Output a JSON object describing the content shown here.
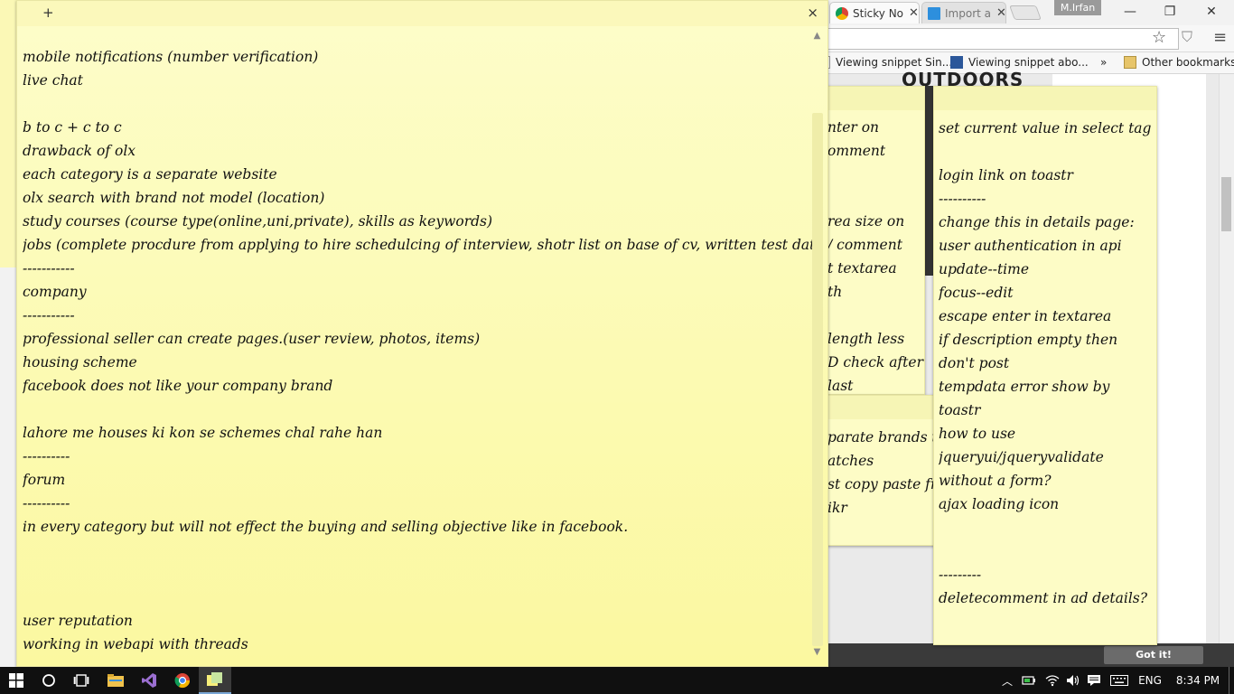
{
  "browser": {
    "tabs": [
      {
        "label": "Sticky No",
        "active": true,
        "icon": "chrome-icon"
      },
      {
        "label": "Import a",
        "active": false,
        "icon": "windows-icon"
      }
    ],
    "user_chip": "M.Irfan",
    "bookmarks": [
      {
        "label": "Viewing snippet Sin...",
        "icon": "document-icon"
      },
      {
        "label": "Viewing snippet abo...",
        "icon": "blogger-icon"
      },
      {
        "label": "»",
        "icon": ""
      },
      {
        "label": "Other bookmarks",
        "icon": "folder-icon"
      }
    ],
    "page_heading": "OUTDOORS",
    "got_it_label": "Got it!"
  },
  "main_note": {
    "add_symbol": "+",
    "close_symbol": "×",
    "lines": [
      "mobile notifications (number verification)",
      "live chat",
      "",
      "b to c + c to c",
      "drawback of olx",
      "each category is a separate website",
      "olx search with brand not model (location)",
      "study courses (course type(online,uni,private), skills as keywords)",
      "jobs (complete procdure from applying to hire schedulcing of interview, shotr list on base of cv, written test date)",
      "-----------",
      "company",
      "-----------",
      "professional seller can create pages.(user review, photos, items)",
      "housing scheme",
      "facebook does not like your company brand",
      "",
      "lahore me houses ki kon se schemes chal rahe han",
      "----------",
      "forum",
      "----------",
      "in every category but will not effect the buying and selling objective like in facebook.",
      "",
      "",
      "",
      "user reputation",
      "working in webapi with threads"
    ]
  },
  "mid_note": {
    "lines": [
      "nter on",
      "omment",
      "",
      "",
      "rea size on",
      "/ comment",
      "t textarea",
      "th",
      "",
      "length less",
      "D check after",
      "last"
    ]
  },
  "mid2_note": {
    "lines": [
      "parate brands t",
      "atches",
      "st copy paste fr",
      "ikr"
    ]
  },
  "right_note": {
    "lines": [
      "set current value in select tag",
      "",
      "login link on toastr",
      "----------",
      "change this in details page:",
      "user authentication in api",
      "update--time",
      "focus--edit",
      "escape enter in textarea",
      "if description empty then",
      "don't post",
      "tempdata error show by",
      "toastr",
      "how to use",
      "jqueryui/jqueryvalidate",
      "without a form?",
      "ajax loading icon",
      "",
      "",
      "---------",
      "deletecomment in ad details?"
    ]
  },
  "taskbar": {
    "language": "ENG",
    "time": "8:34 PM",
    "pinned": [
      {
        "name": "start-button",
        "icon": "windows-logo-icon"
      },
      {
        "name": "cortana-button",
        "icon": "circle-icon"
      },
      {
        "name": "task-view-button",
        "icon": "task-view-icon"
      },
      {
        "name": "file-explorer-button",
        "icon": "folder-icon"
      },
      {
        "name": "visual-studio-button",
        "icon": "visual-studio-icon"
      },
      {
        "name": "chrome-button",
        "icon": "chrome-icon"
      },
      {
        "name": "sticky-notes-button",
        "icon": "sticky-notes-icon"
      }
    ]
  }
}
